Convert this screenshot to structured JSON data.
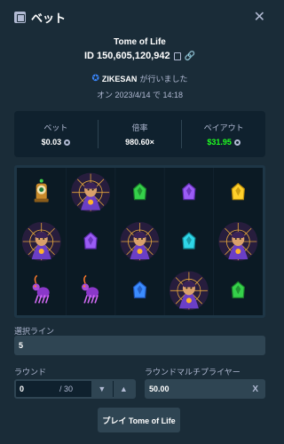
{
  "header": {
    "title": "ベット",
    "close_icon": "close-icon"
  },
  "bet": {
    "game": "Tome of Life",
    "id": "ID 150,605,120,942",
    "player_name": "ZIKESAN",
    "player_suffix": "が行いました",
    "date": "オン 2023/4/14 で 14:18"
  },
  "stats": {
    "bet_label": "ベット",
    "bet_value": "$0.03",
    "multiplier_label": "倍率",
    "multiplier_value": "980.60×",
    "payout_label": "ペイアウト",
    "payout_value": "$31.95",
    "payout_color": "#1fff20"
  },
  "reels": {
    "columns": [
      [
        "eye-idol",
        "sorceress",
        "spider"
      ],
      [
        "sorceress",
        "purple-gem",
        "spider"
      ],
      [
        "green-gem",
        "sorceress",
        "blue-gem"
      ],
      [
        "purple-gem",
        "cyan-gem",
        "sorceress"
      ],
      [
        "yellow-gem",
        "sorceress",
        "green-gem"
      ]
    ]
  },
  "form": {
    "lines_label": "選択ライン",
    "lines_value": "5",
    "round_label": "ラウンド",
    "round_value": "0",
    "round_max": "/ 30",
    "multiplier_label": "ラウンドマルチプライヤー",
    "multiplier_value": "50.00",
    "multiplier_clear": "X"
  },
  "play_button": "プレイ Tome of Life"
}
